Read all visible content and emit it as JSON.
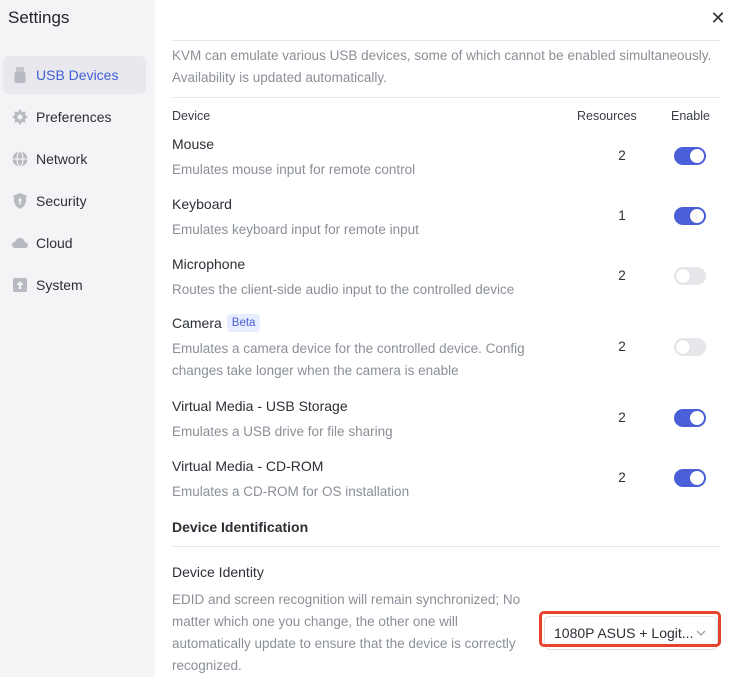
{
  "app": {
    "title": "Settings"
  },
  "sidebar": {
    "items": [
      {
        "label": "USB Devices",
        "icon": "usb-icon",
        "active": true
      },
      {
        "label": "Preferences",
        "icon": "gear-icon",
        "active": false
      },
      {
        "label": "Network",
        "icon": "globe-icon",
        "active": false
      },
      {
        "label": "Security",
        "icon": "shield-icon",
        "active": false
      },
      {
        "label": "Cloud",
        "icon": "cloud-icon",
        "active": false
      },
      {
        "label": "System",
        "icon": "system-icon",
        "active": false
      }
    ]
  },
  "main": {
    "intro": "KVM can emulate various USB devices, some of which cannot be enabled simultaneously. Availability is updated automatically.",
    "columns": {
      "device": "Device",
      "resources": "Resources",
      "enable": "Enable"
    },
    "devices": [
      {
        "name": "Mouse",
        "badge": "",
        "description": "Emulates mouse input for remote control",
        "resources": "2",
        "enabled": true
      },
      {
        "name": "Keyboard",
        "badge": "",
        "description": "Emulates keyboard input for remote input",
        "resources": "1",
        "enabled": true
      },
      {
        "name": "Microphone",
        "badge": "",
        "description": "Routes the client-side audio input to the controlled device",
        "resources": "2",
        "enabled": false
      },
      {
        "name": "Camera",
        "badge": "Beta",
        "description": "Emulates a camera device for the controlled device. Config changes take longer when the camera is enable",
        "resources": "2",
        "enabled": false
      },
      {
        "name": "Virtual Media - USB Storage",
        "badge": "",
        "description": "Emulates a USB drive for file sharing",
        "resources": "2",
        "enabled": true
      },
      {
        "name": "Virtual Media - CD-ROM",
        "badge": "",
        "description": "Emulates a CD-ROM for OS installation",
        "resources": "2",
        "enabled": true
      }
    ],
    "identification": {
      "section_title": "Device Identification",
      "title": "Device Identity",
      "description": "EDID and screen recognition will remain synchronized; No matter which one you change, the other one will automatically update to ensure that the device is correctly recognized.",
      "selected": "1080P ASUS + Logit..."
    }
  },
  "colors": {
    "accent": "#4a5fd8",
    "highlight": "#e8412c",
    "toggle_off": "#e6e7ea"
  }
}
